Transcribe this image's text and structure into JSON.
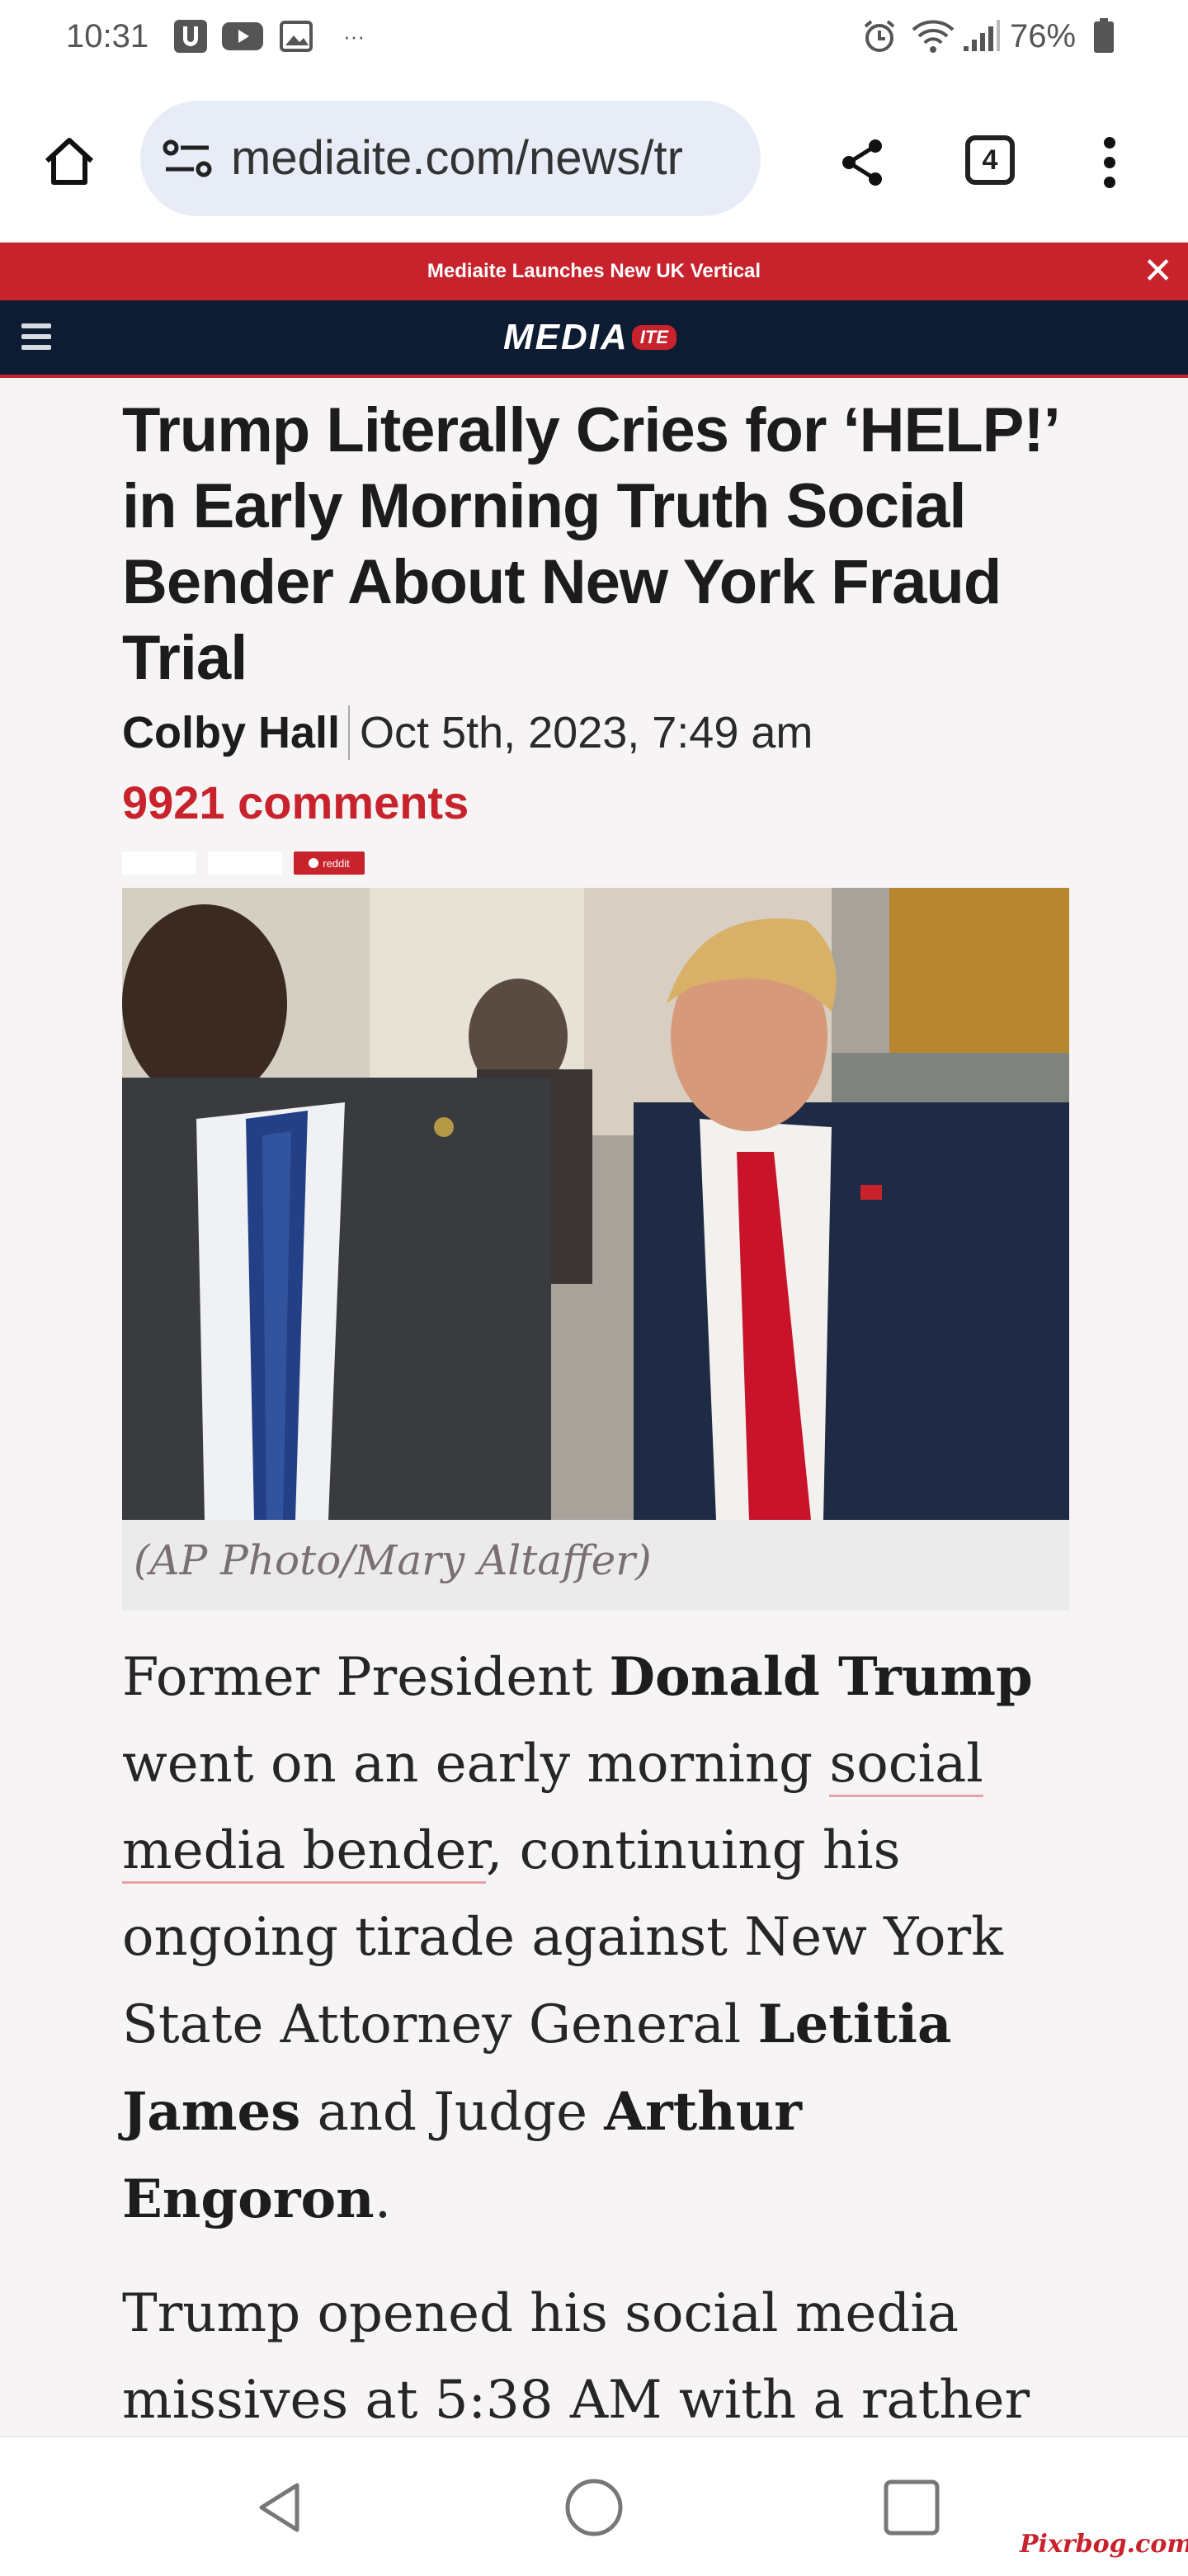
{
  "status_bar": {
    "time": "10:31",
    "battery_percent": "76%",
    "notification_more": "···",
    "icons": [
      "u-app-icon",
      "youtube-icon",
      "gallery-icon",
      "alarm-icon",
      "wifi-icon",
      "signal-icon",
      "battery-icon"
    ]
  },
  "browser": {
    "url": "mediaite.com/news/tr",
    "tab_count": "4",
    "icons": [
      "home-icon",
      "site-settings-icon",
      "share-icon",
      "tabs-icon",
      "more-vert-icon"
    ]
  },
  "promo_banner": {
    "text": "Mediaite Launches New UK Vertical",
    "close_symbol": "✕"
  },
  "site": {
    "logo_main": "MEDIA",
    "logo_tag": "ITE"
  },
  "article": {
    "headline": "Trump Literally Cries for ‘HELP!’ in Early Morning Truth Social Bender About New York Fraud Trial",
    "author": "Colby Hall",
    "date": "Oct 5th, 2023, 7:49 am",
    "comments": "9921 comments",
    "share_reddit_label": "reddit",
    "photo_caption": "(AP Photo/Mary Altaffer)",
    "p1": {
      "t1": "Former President ",
      "b1": "Donald Trump",
      "t2": " went on an early morning ",
      "link": "social media bender",
      "t3": ", continuing his ongoing tirade against New York State Attorney General ",
      "b2": "Letitia James",
      "t4": " and Judge ",
      "b3": "Arthur Engoron",
      "t5": "."
    },
    "p2": "Trump opened his social media missives at 5:38 AM with a rather"
  },
  "watermark": "Pixrbog.com",
  "colors": {
    "accent_red": "#c8232c",
    "nav_navy": "#0d1b33",
    "url_bar": "#e8ecf7"
  }
}
